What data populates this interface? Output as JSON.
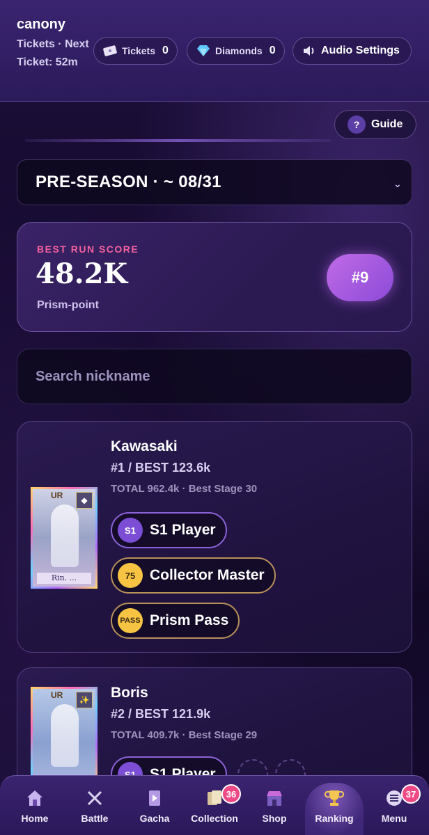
{
  "header": {
    "username": "canony",
    "ticket_note": "Tickets · Next Ticket: 52m",
    "tickets": {
      "label": "Tickets",
      "value": "0",
      "icon": "ticket-icon"
    },
    "diamonds": {
      "label": "Diamonds",
      "value": "0",
      "icon": "diamond-icon"
    },
    "audio": {
      "label": "Audio Settings",
      "icon": "speaker-icon"
    }
  },
  "guide": {
    "label": "Guide",
    "icon_text": "?"
  },
  "season": {
    "selected": "PRE-SEASON · ~ 08/31"
  },
  "score_card": {
    "label": "BEST RUN SCORE",
    "value": "48.2K",
    "unit": "Prism-point",
    "rank": "#9"
  },
  "search": {
    "placeholder": "Search nickname"
  },
  "leaderboard": [
    {
      "card_rarity": "UR",
      "card_name": "Rin. ...",
      "name": "Kawasaki",
      "rank_line": "#1 / BEST 123.6k",
      "total_line": "TOTAL 962.4k · Best Stage 30",
      "badges": [
        {
          "icon_text": "S1",
          "label": "S1 Player",
          "style": "purple"
        },
        {
          "icon_text": "75",
          "label": "Collector Master",
          "style": "gold"
        },
        {
          "icon_text": "PASS",
          "label": "Prism Pass",
          "style": "gold"
        }
      ]
    },
    {
      "card_rarity": "UR",
      "name": "Boris",
      "rank_line": "#2 / BEST 121.9k",
      "total_line": "TOTAL 409.7k · Best Stage 29",
      "badges": [
        {
          "icon_text": "S1",
          "label": "S1 Player",
          "style": "purple"
        }
      ]
    }
  ],
  "nav": [
    {
      "label": "Home",
      "icon": "home-icon"
    },
    {
      "label": "Battle",
      "icon": "swords-icon"
    },
    {
      "label": "Gacha",
      "icon": "card-play-icon"
    },
    {
      "label": "Collection",
      "icon": "cards-icon",
      "badge": "36"
    },
    {
      "label": "Shop",
      "icon": "shop-icon"
    },
    {
      "label": "Ranking",
      "icon": "trophy-icon",
      "active": true
    },
    {
      "label": "Menu",
      "icon": "menu-icon",
      "badge": "37"
    }
  ],
  "colors": {
    "accent_pink": "#f5609e",
    "rank_badge": "#c06be6",
    "nav_badge": "#f04a86"
  }
}
